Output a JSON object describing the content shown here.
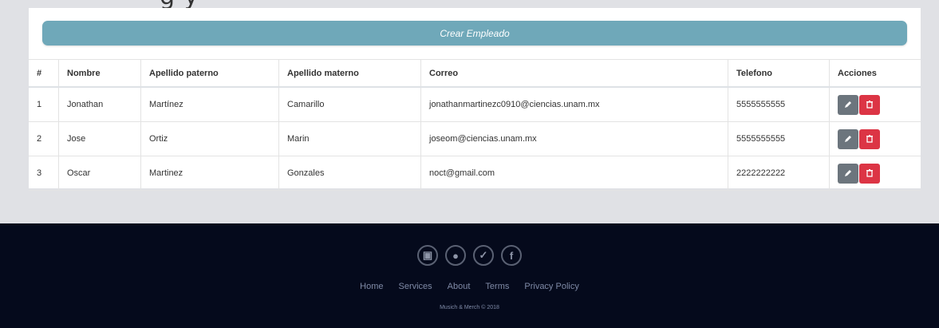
{
  "header": {
    "title_fragment": "g   y"
  },
  "create_button_label": "Crear Empleado",
  "table": {
    "columns": [
      "#",
      "Nombre",
      "Apellido paterno",
      "Apellido materno",
      "Correo",
      "Telefono",
      "Acciones"
    ],
    "rows": [
      {
        "num": "1",
        "nombre": "Jonathan",
        "paterno": "Martínez",
        "materno": "Camarillo",
        "correo": "jonathanmartinezc0910@ciencias.unam.mx",
        "telefono": "5555555555"
      },
      {
        "num": "2",
        "nombre": "Jose",
        "paterno": "Ortiz",
        "materno": "Marin",
        "correo": "joseom@ciencias.unam.mx",
        "telefono": "5555555555"
      },
      {
        "num": "3",
        "nombre": "Oscar",
        "paterno": "Martinez",
        "materno": "Gonzales",
        "correo": "noct@gmail.com",
        "telefono": "2222222222"
      }
    ]
  },
  "footer": {
    "social": [
      "instagram-icon",
      "snapchat-icon",
      "twitter-icon",
      "facebook-icon"
    ],
    "links": [
      "Home",
      "Services",
      "About",
      "Terms",
      "Privacy Policy"
    ],
    "copyright": "Musich & Merch © 2018"
  },
  "colors": {
    "create_button": "#6fa8b9",
    "edit_button": "#6c757d",
    "delete_button": "#dc3545",
    "footer_bg": "#050a1c",
    "page_bg": "#e0e1e5"
  }
}
